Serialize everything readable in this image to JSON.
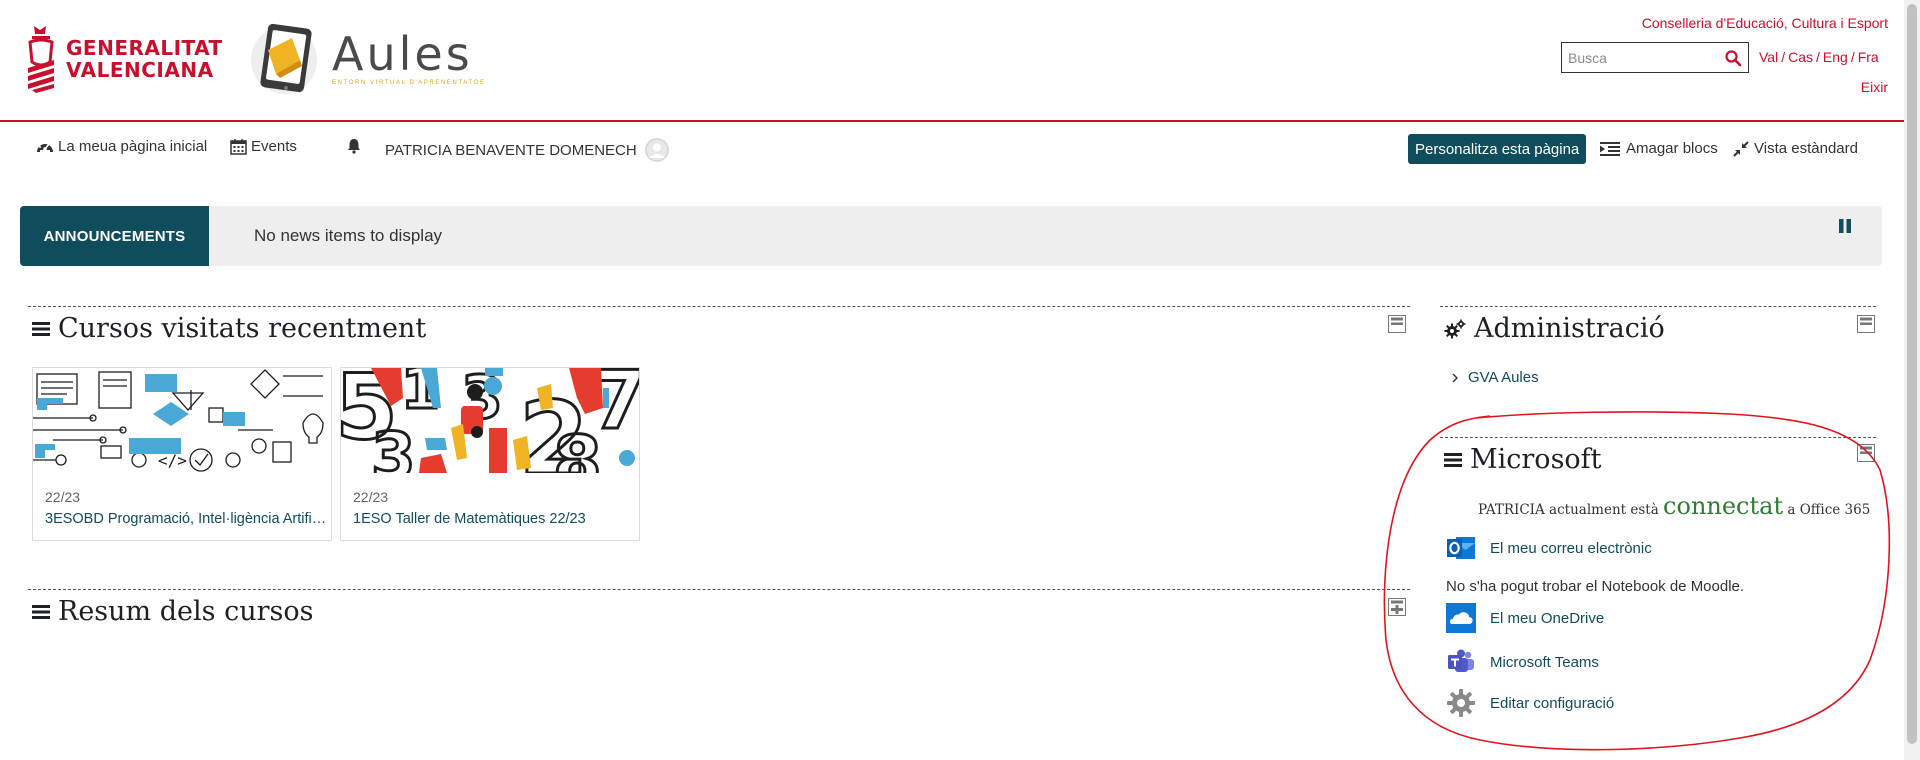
{
  "header": {
    "gva_line1": "GENERALITAT",
    "gva_line2": "VALENCIANA",
    "aules_title": "Aules",
    "aules_subtitle": "ENTORN VIRTUAL D'APRENENTATGE",
    "conselleria": "Conselleria d'Educació, Cultura i Esport",
    "search_placeholder": "Busca",
    "languages": [
      "Val",
      "Cas",
      "Eng",
      "Fra"
    ],
    "logout": "Eixir",
    "brand_color": "#c8102e"
  },
  "nav": {
    "home": "La meua pàgina inicial",
    "events": "Events",
    "user_name": "PATRICIA BENAVENTE DOMENECH",
    "customise": "Personalitza esta pàgina",
    "hide_blocks": "Amagar blocs",
    "standard_view": "Vista estàndard",
    "accent_color": "#0f4c5c"
  },
  "announcements": {
    "label": "ANNOUNCEMENTS",
    "text": "No news items to display"
  },
  "recent_courses": {
    "title": "Cursos visitats recentment",
    "courses": [
      {
        "year": "22/23",
        "name": "3ESOBD Programació, Intel·ligència Artificial"
      },
      {
        "year": "22/23",
        "name": "1ESO Taller de Matemàtiques 22/23"
      }
    ]
  },
  "course_overview": {
    "title": "Resum dels cursos"
  },
  "administration": {
    "title": "Administració",
    "link": "GVA Aules"
  },
  "microsoft": {
    "title": "Microsoft",
    "status_prefix": "PATRICIA actualment està",
    "status_word": "connectat",
    "status_suffix": "a Office 365",
    "email": "El meu correu electrònic",
    "notebook_note": "No s'ha pogut trobar el Notebook de Moodle.",
    "onedrive": "El meu OneDrive",
    "teams": "Microsoft Teams",
    "settings": "Editar configuració"
  }
}
